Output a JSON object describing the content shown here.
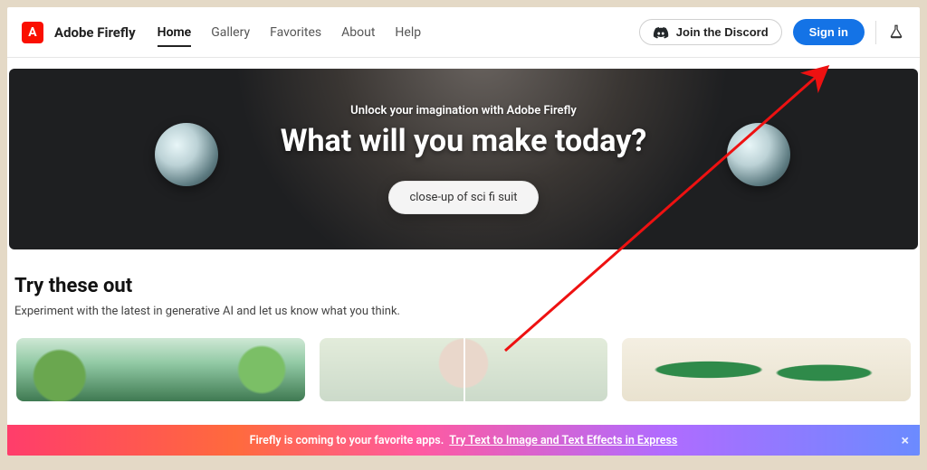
{
  "brand": "Adobe Firefly",
  "nav": {
    "items": [
      {
        "label": "Home",
        "active": true
      },
      {
        "label": "Gallery",
        "active": false
      },
      {
        "label": "Favorites",
        "active": false
      },
      {
        "label": "About",
        "active": false
      },
      {
        "label": "Help",
        "active": false
      }
    ]
  },
  "header": {
    "discord_label": "Join the Discord",
    "signin_label": "Sign in"
  },
  "hero": {
    "subtitle": "Unlock your imagination with Adobe Firefly",
    "title": "What will you make today?",
    "prompt_pill": "close-up of sci fi suit"
  },
  "try_section": {
    "heading": "Try these out",
    "subtext": "Experiment with the latest in generative AI and let us know what you think."
  },
  "cards": [
    {
      "name": "card-jungle"
    },
    {
      "name": "card-portrait-fill"
    },
    {
      "name": "card-leaves"
    }
  ],
  "banner": {
    "lead": "Firefly is coming to your favorite apps.",
    "link": "Try Text to Image and Text Effects in Express"
  },
  "colors": {
    "adobe_red": "#fa0f00",
    "primary_blue": "#1473e6"
  }
}
